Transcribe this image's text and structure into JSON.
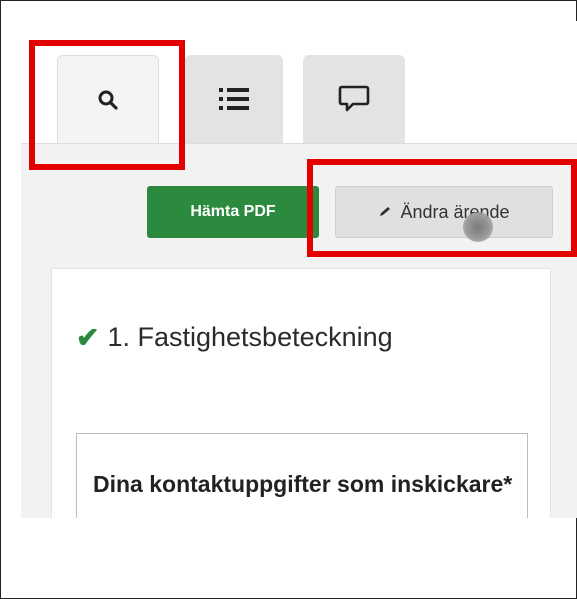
{
  "tabs": [
    {
      "icon": "search-icon",
      "active": true
    },
    {
      "icon": "list-icon",
      "active": false
    },
    {
      "icon": "comment-icon",
      "active": false
    }
  ],
  "toolbar": {
    "pdf_label": "Hämta PDF",
    "edit_label": "Ändra ärende",
    "edit_icon": "pencil-icon"
  },
  "section": {
    "check_icon": "checkmark-icon",
    "title": "1. Fastighetsbeteckning"
  },
  "form": {
    "contact_label": "Dina kontaktuppgifter som inskickare*"
  },
  "colors": {
    "highlight": "#e30000",
    "primary_button": "#2b8a3e",
    "check": "#2b8a3e"
  }
}
